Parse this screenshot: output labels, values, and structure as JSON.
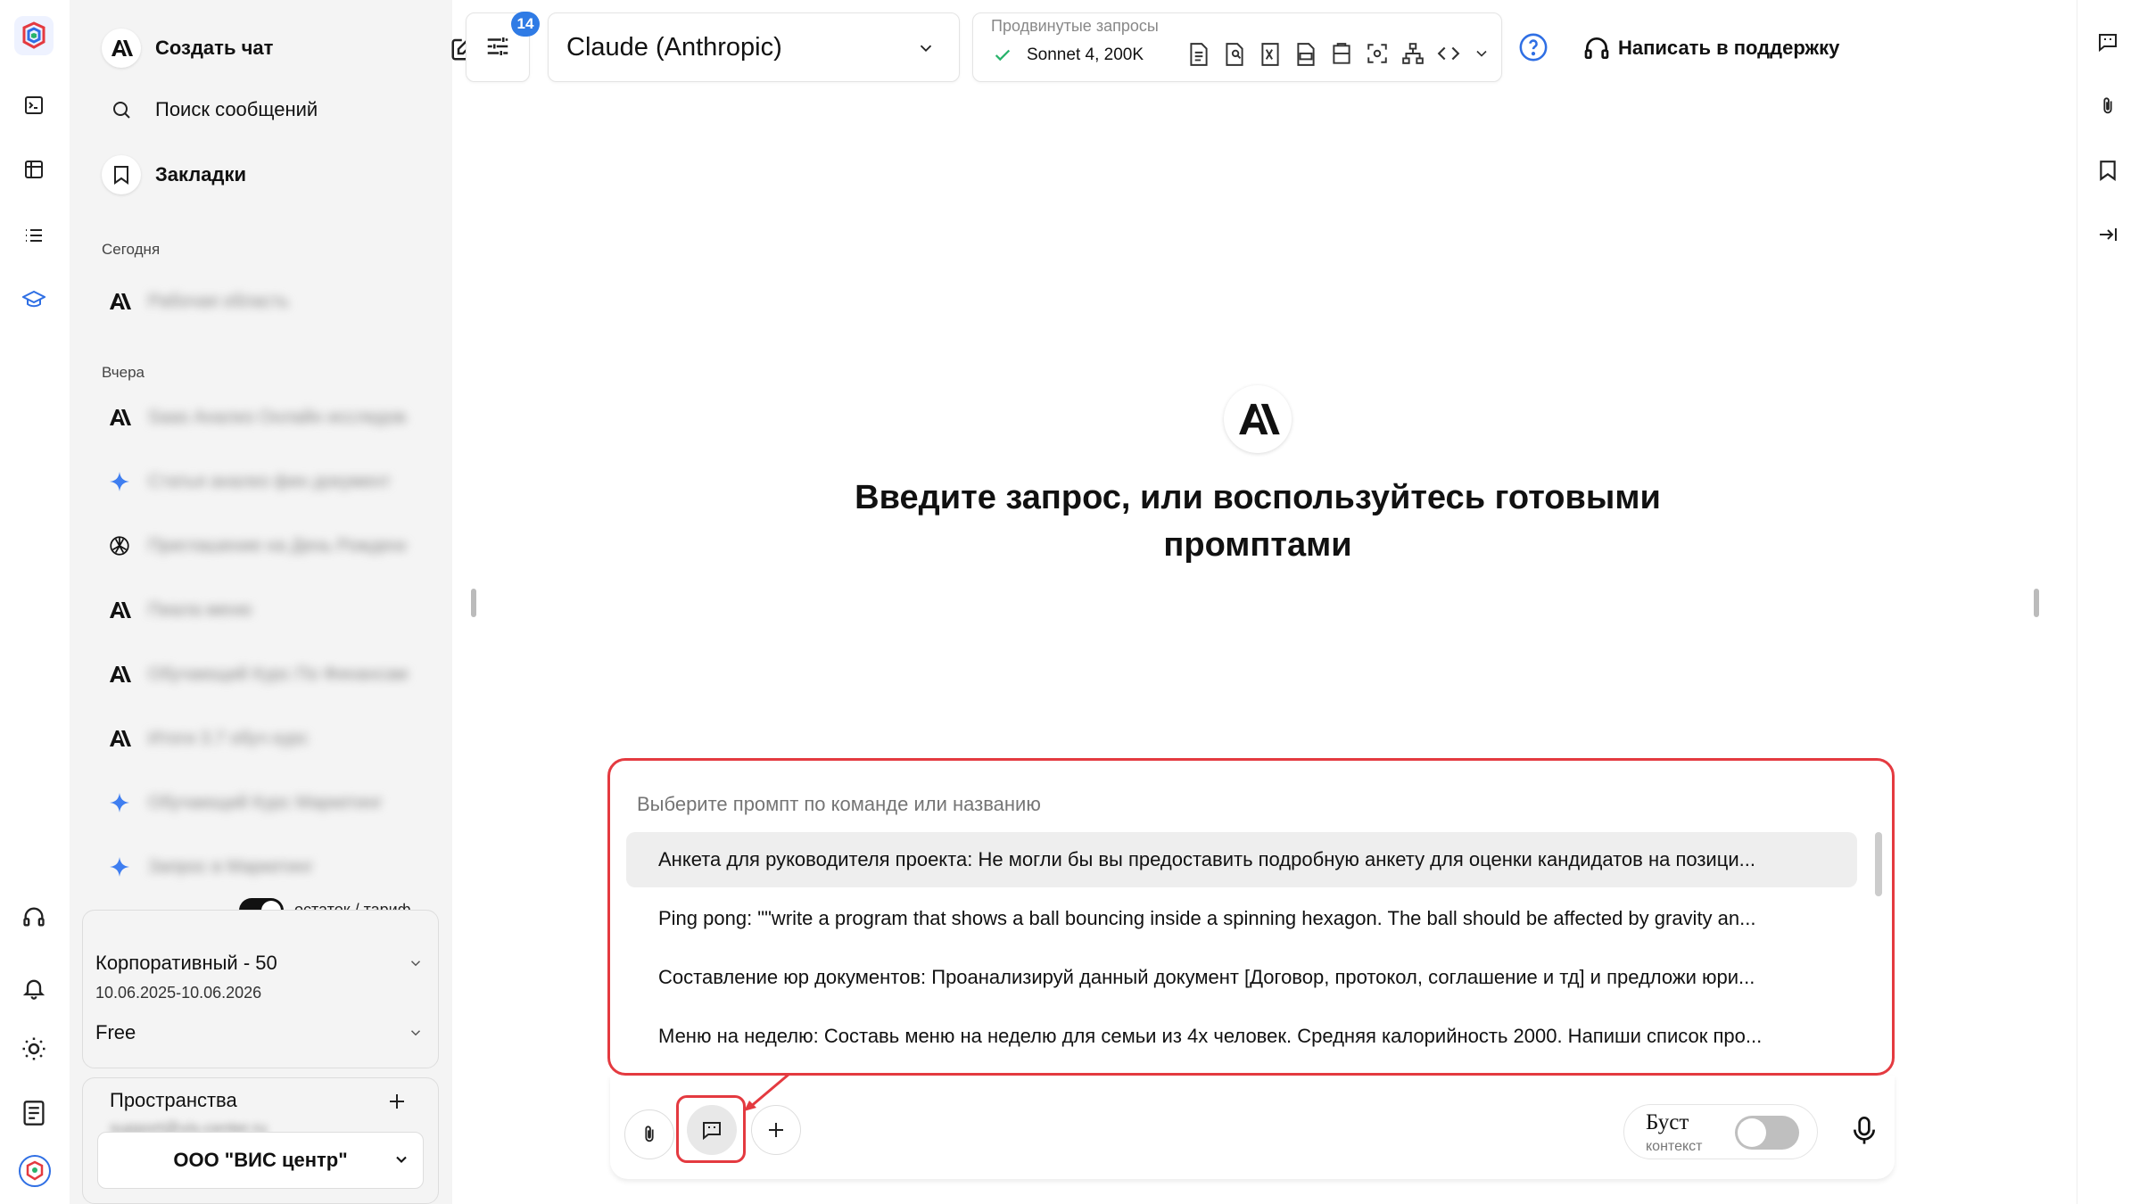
{
  "sidebar": {
    "create_chat": "Создать чат",
    "search": "Поиск сообщений",
    "bookmarks": "Закладки",
    "section_today": "Сегодня",
    "section_yesterday": "Вчера",
    "history": [
      {
        "icon": "anthropic-icon",
        "title": "Рабочая область"
      },
      {
        "icon": "anthropic-icon",
        "title": "Saas Анализ Онлайн исследование"
      },
      {
        "icon": "gemini-star-icon",
        "title": "Статья анализ фин документ"
      },
      {
        "icon": "openai-icon",
        "title": "Приглашение на День Рождения"
      },
      {
        "icon": "anthropic-icon",
        "title": "Пиала меню"
      },
      {
        "icon": "anthropic-icon",
        "title": "Обучающий Курс По Финансам"
      },
      {
        "icon": "anthropic-icon",
        "title": "Итоги 3.7 обуч курс"
      },
      {
        "icon": "gemini-star-icon",
        "title": "Обучающий Курс Маркетинг"
      },
      {
        "icon": "gemini-star-icon",
        "title": "Запрос в Маркетинг"
      }
    ],
    "toggle_label": "остаток / тариф",
    "plan_name": "Корпоративный - 50",
    "plan_dates": "10.06.2025-10.06.2026",
    "plan_free": "Free",
    "spaces_label": "Пространства",
    "spaces_email": "support@vis-center.ru",
    "spaces_org": "ООО \"ВИС центр\""
  },
  "header": {
    "settings_badge": "14",
    "model_name": "Claude (Anthropic)",
    "advanced_label": "Продвинутые запросы",
    "advanced_model": "Sonnet 4, 200K",
    "support": "Написать в поддержку"
  },
  "main": {
    "heading": "Введите запрос, или воспользуйтесь готовыми промптами",
    "prompt_placeholder": "Выберите промпт по команде или названию",
    "prompts": [
      "Анкета для руководителя проекта: Не могли бы вы предоставить подробную анкету для оценки кандидатов на позици...",
      "Ping pong: \"\"write a program that shows a ball bouncing inside a spinning hexagon. The ball should be affected by gravity an...",
      "Составление юр документов: Проанализируй данный документ [Договор, протокол, соглашение и тд] и предложи юри...",
      "Меню на неделю: Составь меню на неделю для семьи из 4х человек. Средняя калорийность 2000. Напиши список про..."
    ],
    "boost_label": "Буст",
    "boost_sub": "контекст"
  },
  "colors": {
    "accent": "#2f6fe4",
    "highlight": "#e43a40",
    "badge": "#2f7be5"
  }
}
